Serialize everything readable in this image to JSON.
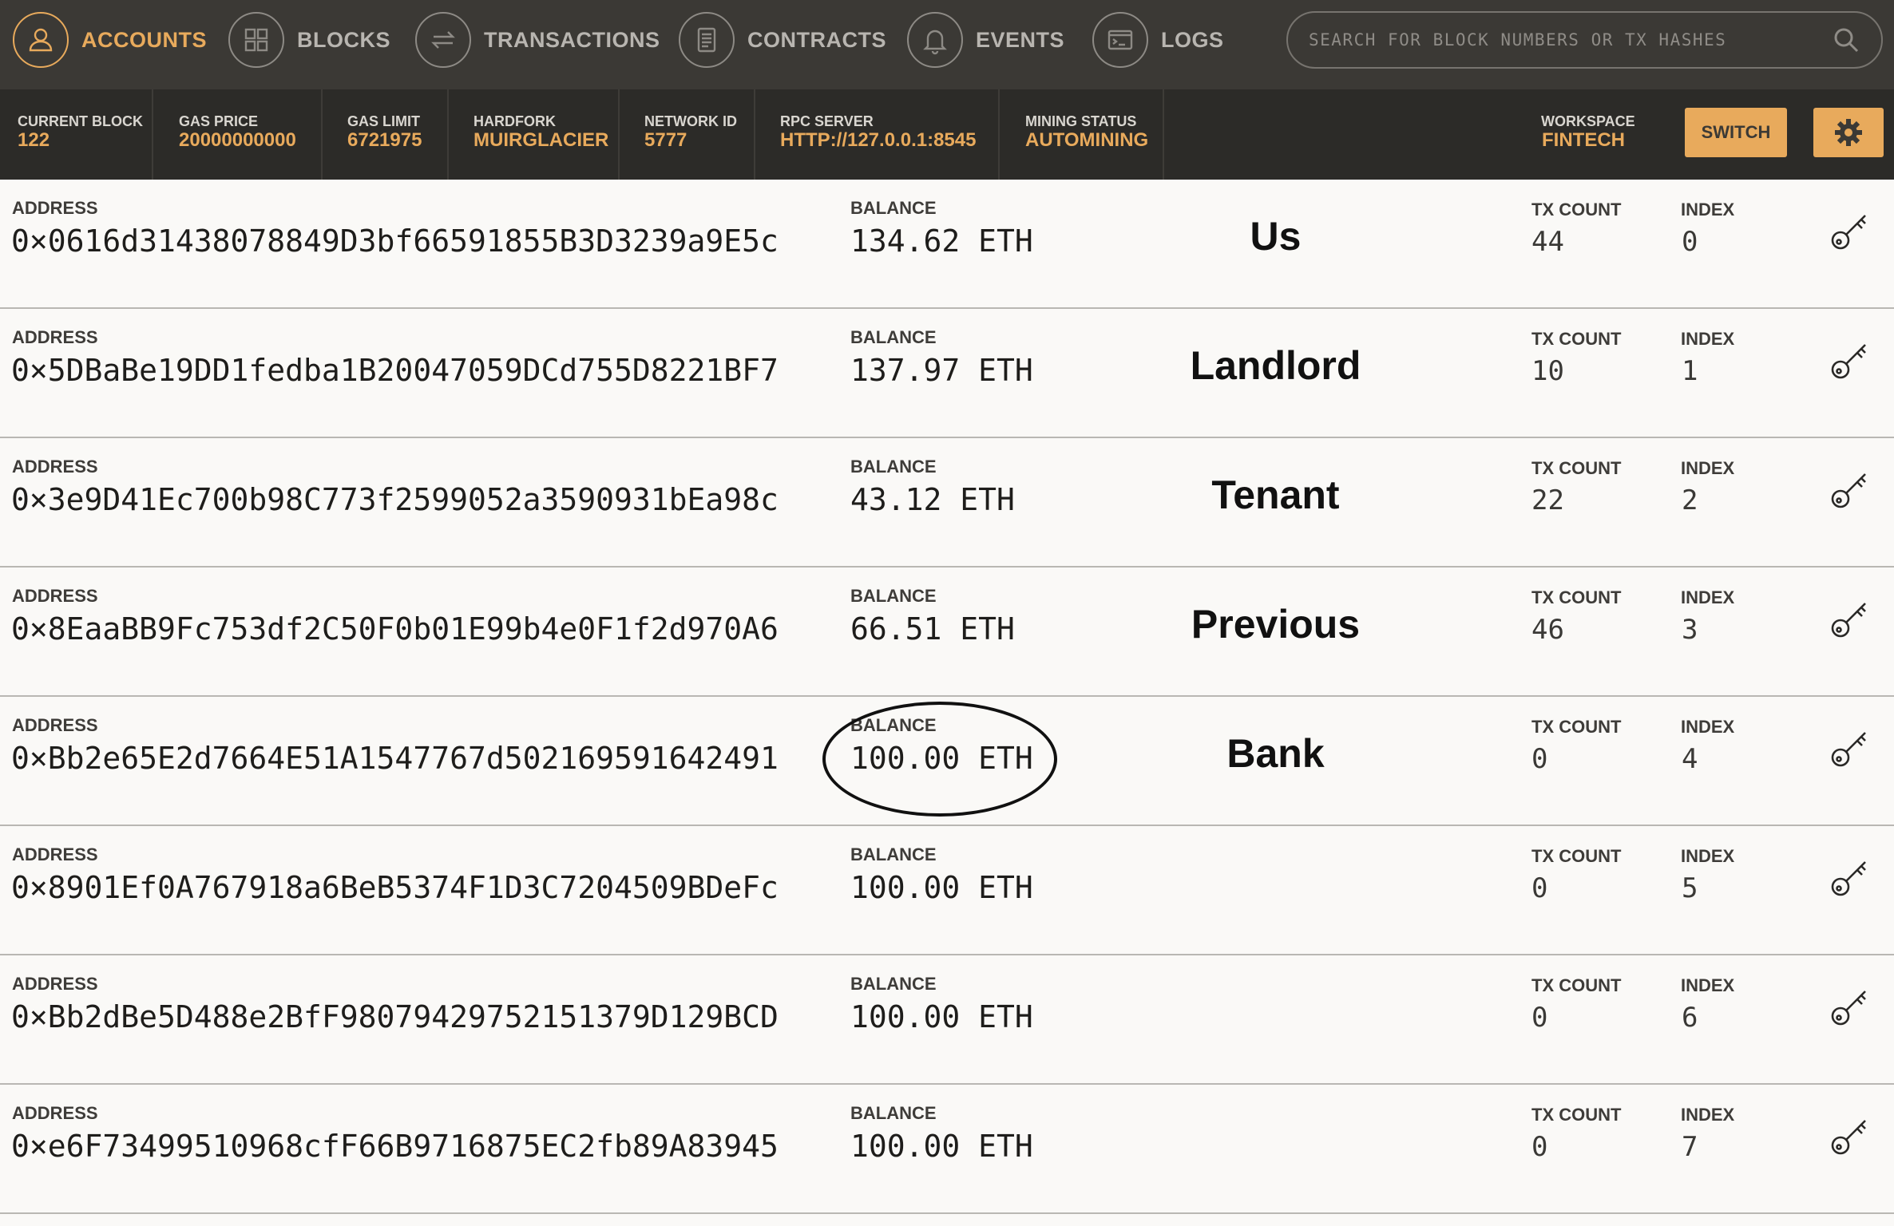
{
  "nav": {
    "items": [
      {
        "label": "ACCOUNTS",
        "icon": "user-icon",
        "active": true
      },
      {
        "label": "BLOCKS",
        "icon": "grid-icon",
        "active": false
      },
      {
        "label": "TRANSACTIONS",
        "icon": "arrows-icon",
        "active": false
      },
      {
        "label": "CONTRACTS",
        "icon": "document-icon",
        "active": false
      },
      {
        "label": "EVENTS",
        "icon": "bell-icon",
        "active": false
      },
      {
        "label": "LOGS",
        "icon": "terminal-icon",
        "active": false
      }
    ],
    "search_placeholder": "SEARCH FOR BLOCK NUMBERS OR TX HASHES"
  },
  "status": {
    "current_block": {
      "label": "CURRENT BLOCK",
      "value": "122"
    },
    "gas_price": {
      "label": "GAS PRICE",
      "value": "20000000000"
    },
    "gas_limit": {
      "label": "GAS LIMIT",
      "value": "6721975"
    },
    "hardfork": {
      "label": "HARDFORK",
      "value": "MUIRGLACIER"
    },
    "network_id": {
      "label": "NETWORK ID",
      "value": "5777"
    },
    "rpc_server": {
      "label": "RPC SERVER",
      "value": "HTTP://127.0.0.1:8545"
    },
    "mining_status": {
      "label": "MINING STATUS",
      "value": "AUTOMINING"
    },
    "workspace": {
      "label": "WORKSPACE",
      "value": "FINTECH"
    },
    "switch_label": "SWITCH"
  },
  "columns": {
    "address": "ADDRESS",
    "balance": "BALANCE",
    "tx_count": "TX COUNT",
    "index": "INDEX"
  },
  "accounts": [
    {
      "address": "0×0616d31438078849D3bf66591855B3D3239a9E5c",
      "balance": "134.62 ETH",
      "annotation": "Us",
      "tx_count": "44",
      "index": "0"
    },
    {
      "address": "0×5DBaBe19DD1fedba1B20047059DCd755D8221BF7",
      "balance": "137.97 ETH",
      "annotation": "Landlord",
      "tx_count": "10",
      "index": "1"
    },
    {
      "address": "0×3e9D41Ec700b98C773f2599052a3590931bEa98c",
      "balance": "43.12 ETH",
      "annotation": "Tenant",
      "tx_count": "22",
      "index": "2"
    },
    {
      "address": "0×8EaaBB9Fc753df2C50F0b01E99b4e0F1f2d970A6",
      "balance": "66.51 ETH",
      "annotation": "Previous",
      "tx_count": "46",
      "index": "3"
    },
    {
      "address": "0×Bb2e65E2d7664E51A1547767d502169591642491",
      "balance": "100.00 ETH",
      "annotation": "Bank",
      "tx_count": "0",
      "index": "4",
      "circled": true
    },
    {
      "address": "0×8901Ef0A767918a6BeB5374F1D3C7204509BDeFc",
      "balance": "100.00 ETH",
      "annotation": "",
      "tx_count": "0",
      "index": "5"
    },
    {
      "address": "0×Bb2dBe5D488e2BfF98079429752151379D129BCD",
      "balance": "100.00 ETH",
      "annotation": "",
      "tx_count": "0",
      "index": "6"
    },
    {
      "address": "0×e6F73499510968cfF66B9716875EC2fb89A83945",
      "balance": "100.00 ETH",
      "annotation": "",
      "tx_count": "0",
      "index": "7"
    }
  ],
  "colors": {
    "accent": "#e8aa5c",
    "nav_bg": "#3b3935",
    "status_bg": "#2c2b28",
    "row_bg": "#faf9f7"
  }
}
